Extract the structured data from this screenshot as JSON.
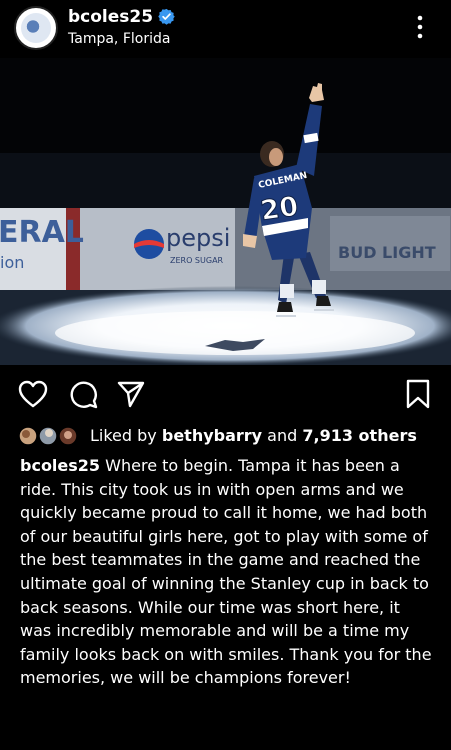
{
  "post": {
    "username": "bcoles25",
    "location": "Tampa, Florida",
    "verified": true,
    "photo": {
      "board_left_text": "ERAL",
      "board_left_sub": "ion",
      "board_brand": "pepsi",
      "board_brand_sub": "ZERO SUGAR",
      "jersey_name": "COLEMAN",
      "jersey_number": "20",
      "board_right_text": "BUD LIGHT"
    },
    "likes": {
      "prefix": "Liked by ",
      "liked_by_user": "bethybarry",
      "connector": " and ",
      "others": "7,913 others"
    },
    "caption_user": "bcoles25",
    "caption_text": "Where to begin. Tampa it has been a ride. This city took us in with open arms and we quickly became proud to call it home, we had both of our beautiful girls here, got to play with some of the best teammates in the game and reached the ultimate goal of winning the Stanley cup in back to back seasons. While our time was short here, it was incredibly memorable and will be a time my family looks back on with smiles. Thank you for the memories, we will be champions forever!"
  },
  "icons": {
    "more": "more-options-icon",
    "verified": "verified-badge-icon",
    "like": "heart-icon",
    "comment": "comment-icon",
    "share": "share-icon",
    "save": "bookmark-icon"
  },
  "colors": {
    "background": "#000000",
    "text": "#ffffff",
    "verified": "#3897f0",
    "jersey": "#1d3a7a"
  }
}
